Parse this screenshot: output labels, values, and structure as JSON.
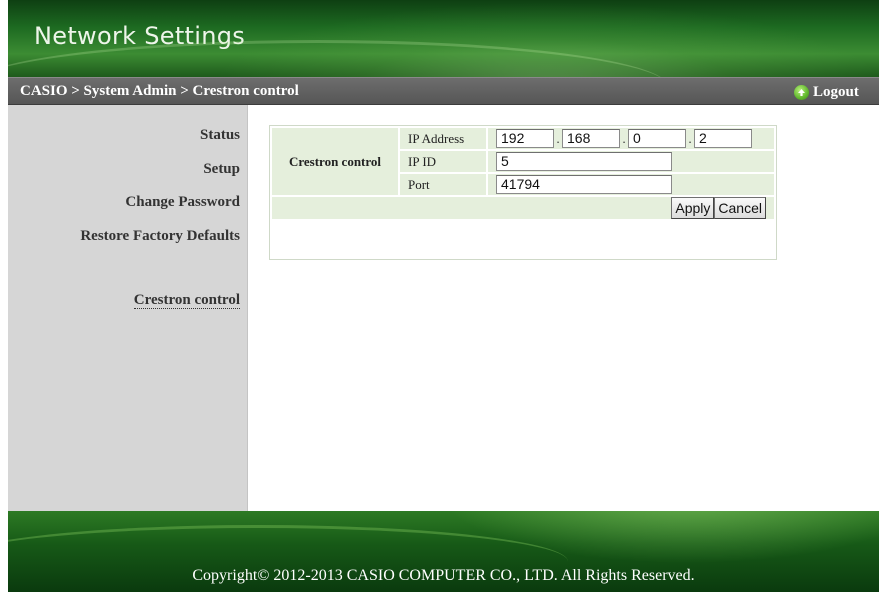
{
  "app": {
    "title": "Network Settings"
  },
  "breadcrumb": {
    "text": "CASIO > System Admin > Crestron control"
  },
  "logout": {
    "label": "Logout"
  },
  "sidebar": {
    "items": [
      {
        "label": "Status"
      },
      {
        "label": "Setup"
      },
      {
        "label": "Change Password"
      },
      {
        "label": "Restore Factory Defaults"
      },
      {
        "label": "Crestron control",
        "active": true
      }
    ]
  },
  "form": {
    "group_label": "Crestron control",
    "ip_address": {
      "label": "IP Address",
      "octets": [
        "192",
        "168",
        "0",
        "2"
      ]
    },
    "ip_id": {
      "label": "IP ID",
      "value": "5"
    },
    "port": {
      "label": "Port",
      "value": "41794"
    },
    "apply_label": "Apply",
    "cancel_label": "Cancel"
  },
  "footer": {
    "copyright": "Copyright© 2012-2013 CASIO COMPUTER CO., LTD. All Rights Reserved."
  },
  "colors": {
    "brand_green": "#1d6a21",
    "navbar_gray": "#5f5f5f",
    "sidebar_gray": "#d6d6d6",
    "form_cell": "#e5efdc"
  }
}
